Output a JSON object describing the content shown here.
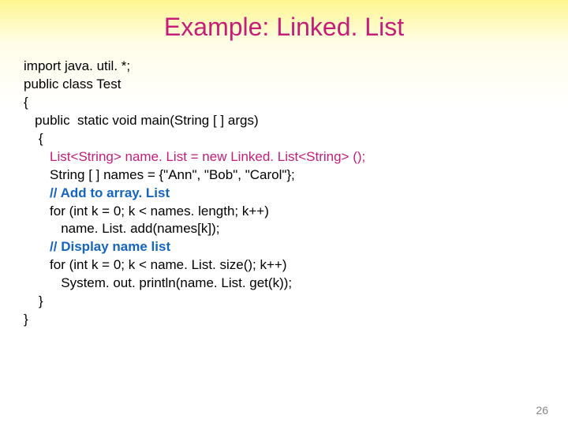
{
  "title": "Example: Linked. List",
  "code": {
    "l1": "import java. util. *;",
    "l2": "public class Test",
    "l3": "{",
    "l4": "   public  static void main(String [ ] args)",
    "l5": "    {",
    "l6": "       List<String> name. List = new Linked. List<String> ();",
    "l7": "       String [ ] names = {\"Ann\", \"Bob\", \"Carol\"};",
    "l8": "",
    "c1": "       // Add to array. List",
    "l9": "       for (int k = 0; k < names. length; k++)",
    "l10": "          name. List. add(names[k]);",
    "l11": "",
    "c2": "       // Display name list",
    "l12": "       for (int k = 0; k < name. List. size(); k++)",
    "l13": "          System. out. println(name. List. get(k));",
    "l14": "    }",
    "l15": "}"
  },
  "page_number": "26"
}
